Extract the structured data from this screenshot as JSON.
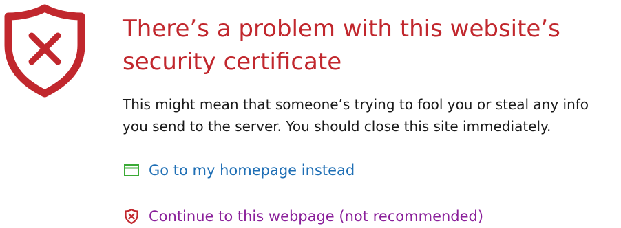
{
  "page": {
    "title_line1": "There’s a problem with this website’s",
    "title_line2": "security certificate",
    "description_line1": "This might mean that someone’s trying to fool you or steal any info",
    "description_line2": "you send to the server. You should close this site immediately."
  },
  "actions": {
    "homepage_label": "Go to my homepage instead",
    "homepage_icon": "window-icon",
    "continue_label": "Continue to this webpage (not recommended)",
    "continue_icon": "shield-x-icon"
  },
  "colors": {
    "alert_red": "#c1272d",
    "link_blue": "#1f6fb5",
    "link_purple": "#8a1f9a",
    "homepage_icon_green": "#3aaa35"
  }
}
